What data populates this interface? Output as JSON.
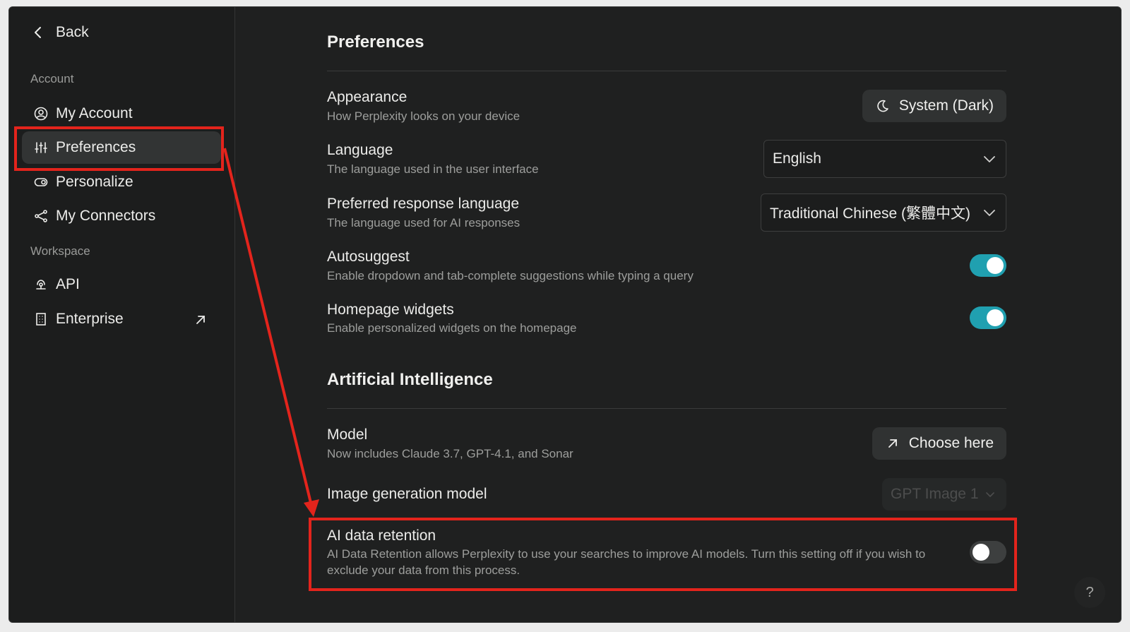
{
  "nav": {
    "back_label": "Back",
    "account_label": "Account",
    "workspace_label": "Workspace",
    "items": [
      {
        "label": "My Account",
        "icon": "user-circle-icon"
      },
      {
        "label": "Preferences",
        "icon": "sliders-icon",
        "active": true
      },
      {
        "label": "Personalize",
        "icon": "toggle-icon"
      },
      {
        "label": "My Connectors",
        "icon": "share-nodes-icon"
      },
      {
        "label": "API",
        "icon": "api-icon"
      },
      {
        "label": "Enterprise",
        "icon": "building-icon",
        "external": true
      }
    ]
  },
  "preferences": {
    "title": "Preferences",
    "appearance": {
      "title": "Appearance",
      "desc": "How Perplexity looks on your device",
      "value": "System (Dark)"
    },
    "language": {
      "title": "Language",
      "desc": "The language used in the user interface",
      "value": "English"
    },
    "response_language": {
      "title": "Preferred response language",
      "desc": "The language used for AI responses",
      "value": "Traditional Chinese (繁體中文)"
    },
    "autosuggest": {
      "title": "Autosuggest",
      "desc": "Enable dropdown and tab-complete suggestions while typing a query",
      "on": true
    },
    "widgets": {
      "title": "Homepage widgets",
      "desc": "Enable personalized widgets on the homepage",
      "on": true
    }
  },
  "ai": {
    "title": "Artificial Intelligence",
    "model": {
      "title": "Model",
      "desc": "Now includes Claude 3.7, GPT-4.1, and Sonar",
      "button": "Choose here"
    },
    "image_model": {
      "title": "Image generation model",
      "value": "GPT Image 1"
    },
    "retention": {
      "title": "AI data retention",
      "desc": "AI Data Retention allows Perplexity to use your searches to improve AI models. Turn this setting off if you wish to exclude your data from this process.",
      "on": false
    }
  },
  "help_label": "?",
  "colors": {
    "accent": "#20a0b0",
    "annotation": "#e3241c",
    "background": "#1f2020"
  }
}
